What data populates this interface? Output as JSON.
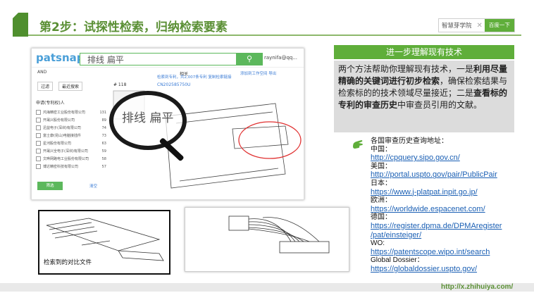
{
  "header": {
    "title": "第2步：试探性检索，归纳检索要素",
    "brand_text": "智慧芽学院",
    "brand_button": "百度一下"
  },
  "screenshot": {
    "logo": "patsnap",
    "search_value": "排线 扁平",
    "user": "raynifa@qq...",
    "and_label": "AND",
    "sort_label": "相关",
    "tools_label": "添加到工作空间  导出",
    "tab1": "过滤",
    "tab2": "最近搜索",
    "list_header": "申请(专利权)人",
    "filters": [
      {
        "name": "鸿海精密工业股份有限公司",
        "count": "131"
      },
      {
        "name": "开晟兴股份有限公司",
        "count": "89"
      },
      {
        "name": "迅益电子(深圳)有限公司",
        "count": "74"
      },
      {
        "name": "富士康(昆山)电脑接插件",
        "count": "73"
      },
      {
        "name": "星河股份有限公司",
        "count": "63"
      },
      {
        "name": "开晟兴全电子(深圳)有限公司",
        "count": "59"
      },
      {
        "name": "文晔网路电工业股份有限公司",
        "count": "58"
      },
      {
        "name": "博达精密科技有限公司",
        "count": "57"
      }
    ],
    "ok_label": "筛选",
    "cancel_label": "清空",
    "result_summary": "检索到专利，共2,007条专利  复制检索链接",
    "result_num": "# 118",
    "patent_number": "CN202585750U"
  },
  "comparison_caption": "检索到的对比文件",
  "right_panel": {
    "heading": "进一步理解现有技术",
    "p1": "两个方法帮助你理解现有技术，一是",
    "b1": "利用尽量精确的关键词进行初步检索",
    "p2": "，确保检索结果与检索标的的技术领域尽量接近；二是",
    "b2": "查看标的专利的审查历史",
    "p3": "中审查员引用的文献。"
  },
  "links": {
    "intro": "各国审查历史查询地址：",
    "china_label": "中国：",
    "china_url": "http://cpquery.sipo.gov.cn/",
    "us_label": "美国：",
    "us_url": "http://portal.uspto.gov/pair/PublicPair",
    "jp_label": "日本：",
    "jp_url": "https://www.j-platpat.inpit.go.jp/",
    "eu_label": "欧洲：",
    "eu_url": "https://worldwide.espacenet.com/",
    "de_label": "德国：",
    "de_url1": "https://register.dpma.de/DPMAregister",
    "de_url2": "/pat/einsteiger/",
    "wo_label": "WO:",
    "wo_url": "https://patentscope.wipo.int/search",
    "gd_label": "Global Dossier：",
    "gd_url": "https://globaldossier.uspto.gov/"
  },
  "footer_url": "http://x.zhihuiya.com/"
}
